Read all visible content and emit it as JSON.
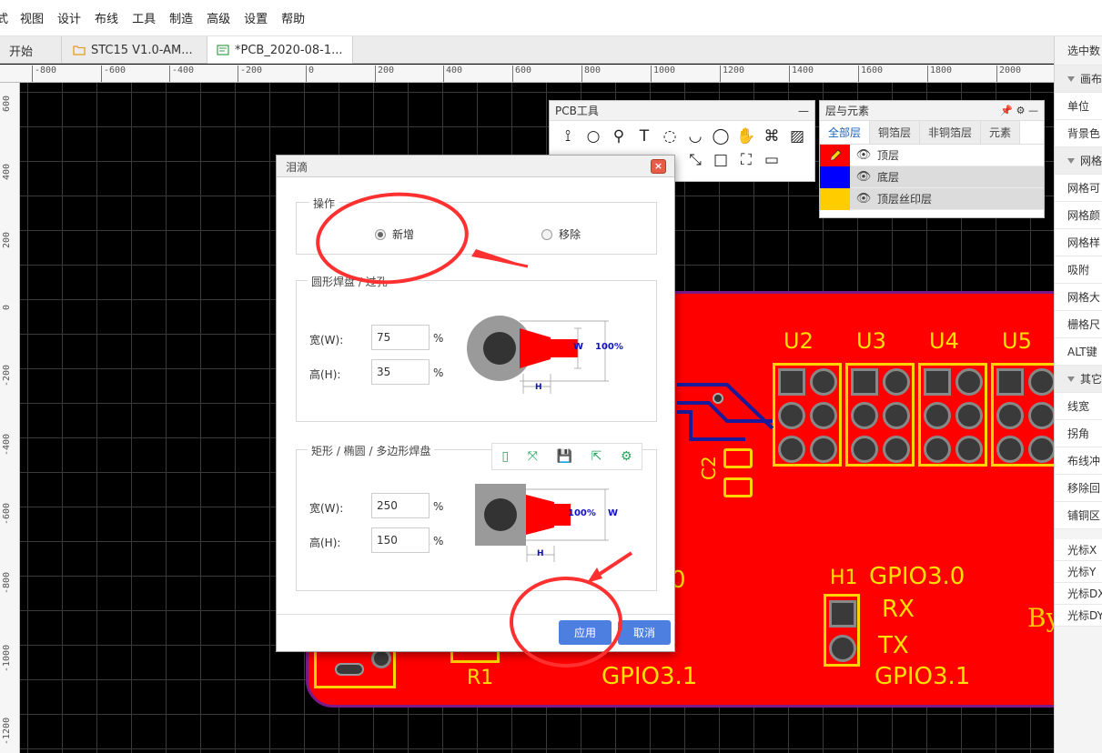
{
  "menu": [
    "式",
    "视图",
    "设计",
    "布线",
    "工具",
    "制造",
    "高级",
    "设置",
    "帮助"
  ],
  "tabs": [
    "开始",
    "STC15 V1.0-AM...",
    "*PCB_2020-08-1..."
  ],
  "ruler_h": [
    "-800",
    "-600",
    "-400",
    "-200",
    "0",
    "200",
    "400",
    "600",
    "800",
    "1000",
    "1200",
    "1400",
    "1600",
    "1800",
    "2000"
  ],
  "ruler_v": [
    "600",
    "400",
    "200",
    "0",
    "-200",
    "-400",
    "-600",
    "-800",
    "-1000",
    "-1200"
  ],
  "right_panel": {
    "title": "选中数",
    "rows": [
      "画布",
      "单位",
      "背景色",
      "网格",
      "网格可",
      "网格颜",
      "网格样",
      "吸附",
      "网格大",
      "栅格尺",
      "ALT键",
      "其它",
      "线宽",
      "拐角",
      "布线冲",
      "移除回",
      "铺铜区"
    ],
    "cursor": [
      "光标X",
      "光标Y",
      "光标DX",
      "光标DY"
    ]
  },
  "pcb_tools": {
    "title": "PCB工具",
    "minimize": "—"
  },
  "layers": {
    "title": "层与元素",
    "tabs": [
      "全部层",
      "铜箔层",
      "非铜箔层",
      "元素"
    ],
    "rows": [
      {
        "name": "顶层",
        "color": "#ff0000"
      },
      {
        "name": "底层",
        "color": "#0000ff"
      },
      {
        "name": "顶层丝印层",
        "color": "#ffcc00"
      }
    ]
  },
  "dialog": {
    "title": "泪滴",
    "close": "×",
    "operation_legend": "操作",
    "opt_add": "新增",
    "opt_remove": "移除",
    "round_legend": "圆形焊盘 / 过孔",
    "round_w_label": "宽(W):",
    "round_w": "75",
    "round_h_label": "高(H):",
    "round_h": "35",
    "rect_legend": "矩形 / 椭圆 / 多边形焊盘",
    "rect_w_label": "宽(W):",
    "rect_w": "250",
    "rect_h_label": "高(H):",
    "rect_h": "150",
    "pct": "%",
    "diag_w": "W",
    "diag_h": "H",
    "diag_100": "100%",
    "apply": "应用",
    "cancel": "取消"
  },
  "silk": {
    "u2": "U2",
    "u3": "U3",
    "u4": "U4",
    "u5": "U5",
    "c2": "C2",
    "h1": "H1",
    "gpio30": "GPIO3.0",
    "rx": "RX",
    "tx": "TX",
    "gpio31a": "GPIO3.1",
    "gpio31b": "GPIO3.1",
    "r1": "R1",
    "by": "By",
    "zero": "0"
  },
  "colors": {
    "board": "#ff0000",
    "silk": "#ffe000",
    "accent": "#4d7fe0"
  }
}
